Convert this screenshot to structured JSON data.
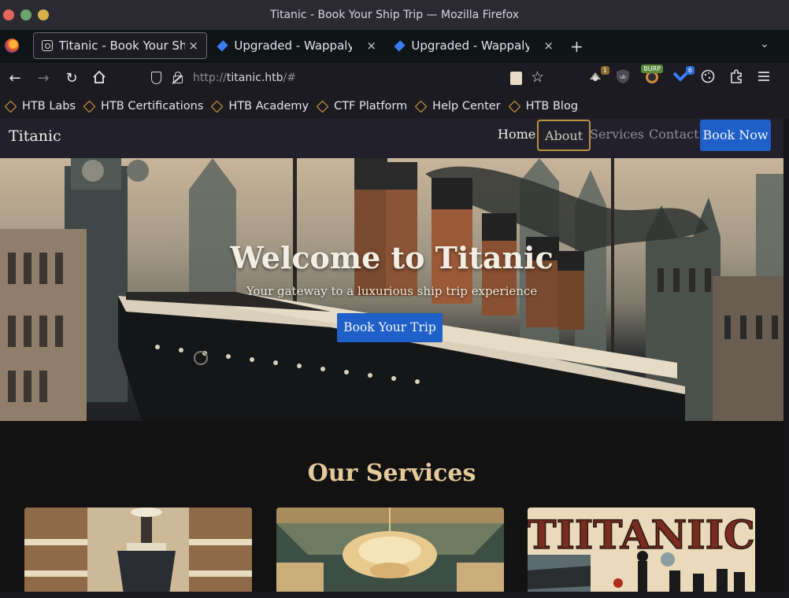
{
  "window": {
    "title": "Titanic - Book Your Ship Trip — Mozilla Firefox",
    "dot_colors": [
      "#e0675a",
      "#6aa56a",
      "#d6b04c"
    ]
  },
  "tabs": [
    {
      "label": "Titanic - Book Your Ship T",
      "active": true
    },
    {
      "label": "Upgraded - Wappalyzer",
      "active": false
    },
    {
      "label": "Upgraded - Wappalyzer",
      "active": false
    }
  ],
  "tab_close_glyph": "×",
  "new_tab_glyph": "+",
  "url": {
    "scheme": "http://",
    "host": "titanic.htb",
    "suffix": "/#"
  },
  "extensions": [
    {
      "name": "notes-extension-icon",
      "badge": "1"
    },
    {
      "name": "ublock-icon",
      "badge": ""
    },
    {
      "name": "burp-proxy-icon",
      "badge": "BURP"
    },
    {
      "name": "wappalyzer-icon",
      "badge": "6"
    }
  ],
  "bookmarks": [
    "HTB Labs",
    "HTB Certifications",
    "HTB Academy",
    "CTF Platform",
    "Help Center",
    "HTB Blog"
  ],
  "site": {
    "brand": "Titanic",
    "nav": {
      "home": "Home",
      "about": "About",
      "services": "Services",
      "contact": "Contact",
      "book_now": "Book Now"
    },
    "hero": {
      "title": "Welcome to Titanic",
      "subtitle": "Your gateway to a luxurious ship trip experience",
      "button": "Book Your Trip"
    },
    "services_title": "Our Services",
    "card3_text": "TIITANIIC"
  },
  "colors": {
    "accent_blue": "#1f5fc8",
    "gold": "#e5c99a",
    "bookmark_icon": "#e2a340"
  }
}
